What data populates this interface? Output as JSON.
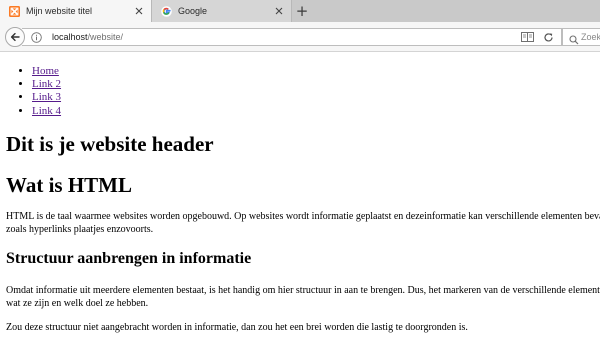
{
  "browser": {
    "tabs": [
      {
        "title": "Mijn website titel",
        "active": true,
        "favicon": "xampp-icon"
      },
      {
        "title": "Google",
        "active": false,
        "favicon": "google-icon"
      }
    ],
    "new_tab_label": "+",
    "url": {
      "host": "localhost",
      "path": "/website/"
    },
    "search_placeholder": "Zoek"
  },
  "page": {
    "nav_links": [
      "Home",
      "Link 2",
      "Link 3",
      "Link 4"
    ],
    "site_header": "Dit is je website header",
    "heading_html": "Wat is HTML",
    "paragraph_1": "HTML is de taal waarmee websites worden opgebouwd. Op websites wordt informatie geplaatst en dezeinformatie kan verschillende elementen bevatten zoals hyperlinks plaatjes enzovoorts.",
    "heading_structure": "Structuur aanbrengen in informatie",
    "paragraph_2": "Omdat informatie uit meerdere elementen bestaat, is het handig om hier structuur in aan te brengen. Dus, het markeren van de verschillende elementen wat ze zijn en welk doel ze hebben.",
    "paragraph_3": "Zou deze structuur niet aangebracht worden in informatie, dan zou het een brei worden die lastig te doorgronden is."
  },
  "colors": {
    "visited_link": "#551a8b",
    "xampp_orange": "#fb7a24",
    "tab_strip": "#c9c9c9",
    "toolbar": "#f6f6f6"
  }
}
